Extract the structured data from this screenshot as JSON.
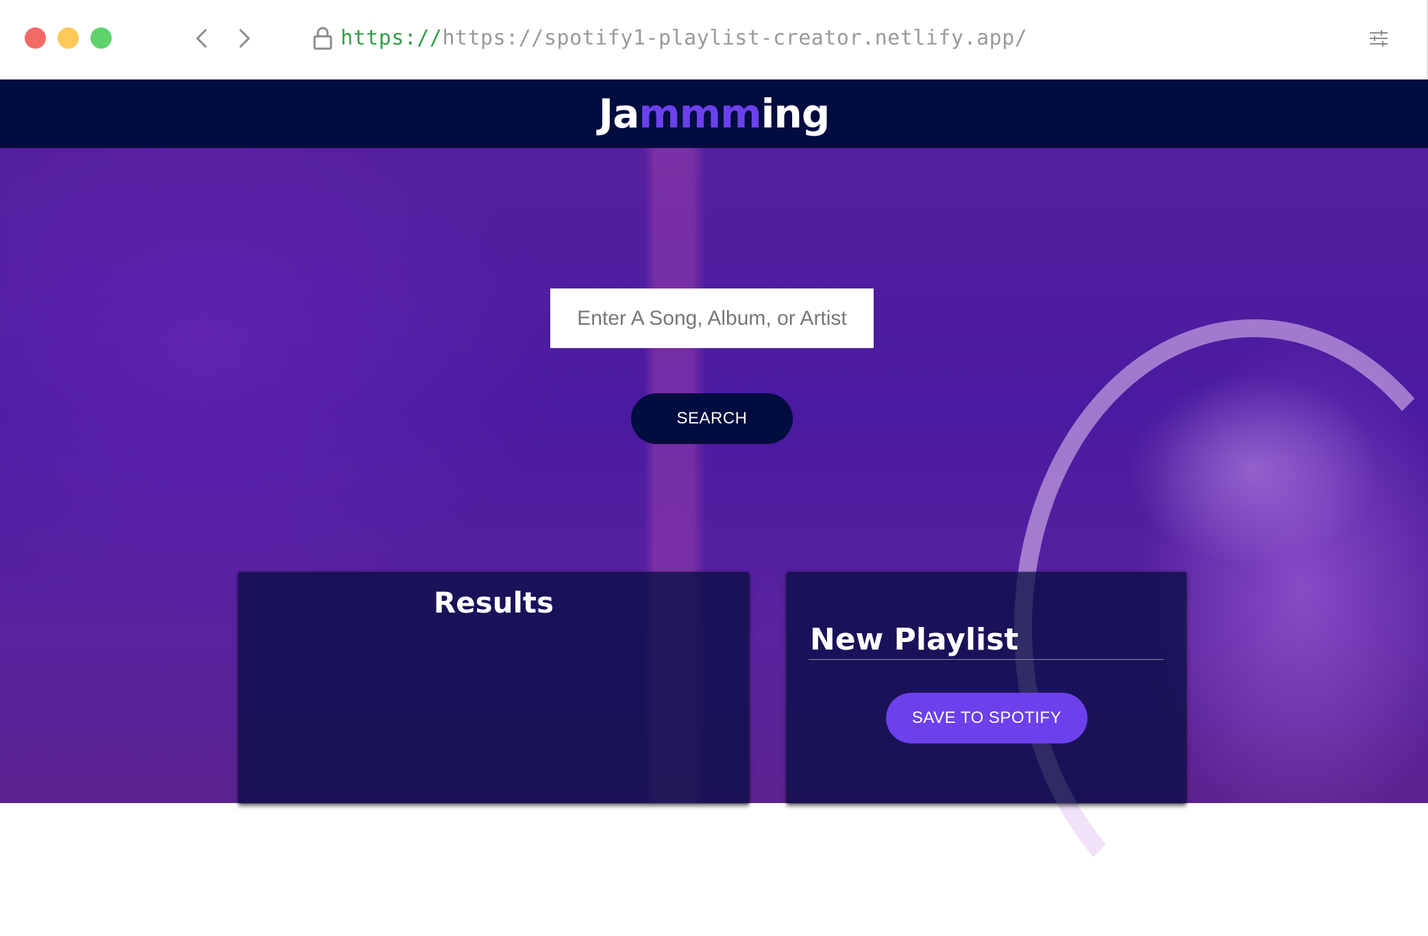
{
  "browser": {
    "url_scheme": "https://",
    "url_rest": "https://spotify1-playlist-creator.netlify.app/",
    "icons": {
      "back": "chevron-left-icon",
      "forward": "chevron-right-icon",
      "lock": "lock-icon",
      "settings": "sliders-icon"
    }
  },
  "app": {
    "logo_prefix": "Ja",
    "logo_accent": "mmm",
    "logo_suffix": "ing"
  },
  "search": {
    "placeholder": "Enter A Song, Album, or Artist",
    "value": "",
    "button_label": "SEARCH"
  },
  "results": {
    "title": "Results",
    "tracks": []
  },
  "playlist": {
    "name": "New Playlist",
    "save_label": "SAVE TO SPOTIFY",
    "tracks": []
  },
  "colors": {
    "header_bg": "#010c3f",
    "accent": "#6c41ec",
    "hero_purple": "#4a1aa0"
  }
}
